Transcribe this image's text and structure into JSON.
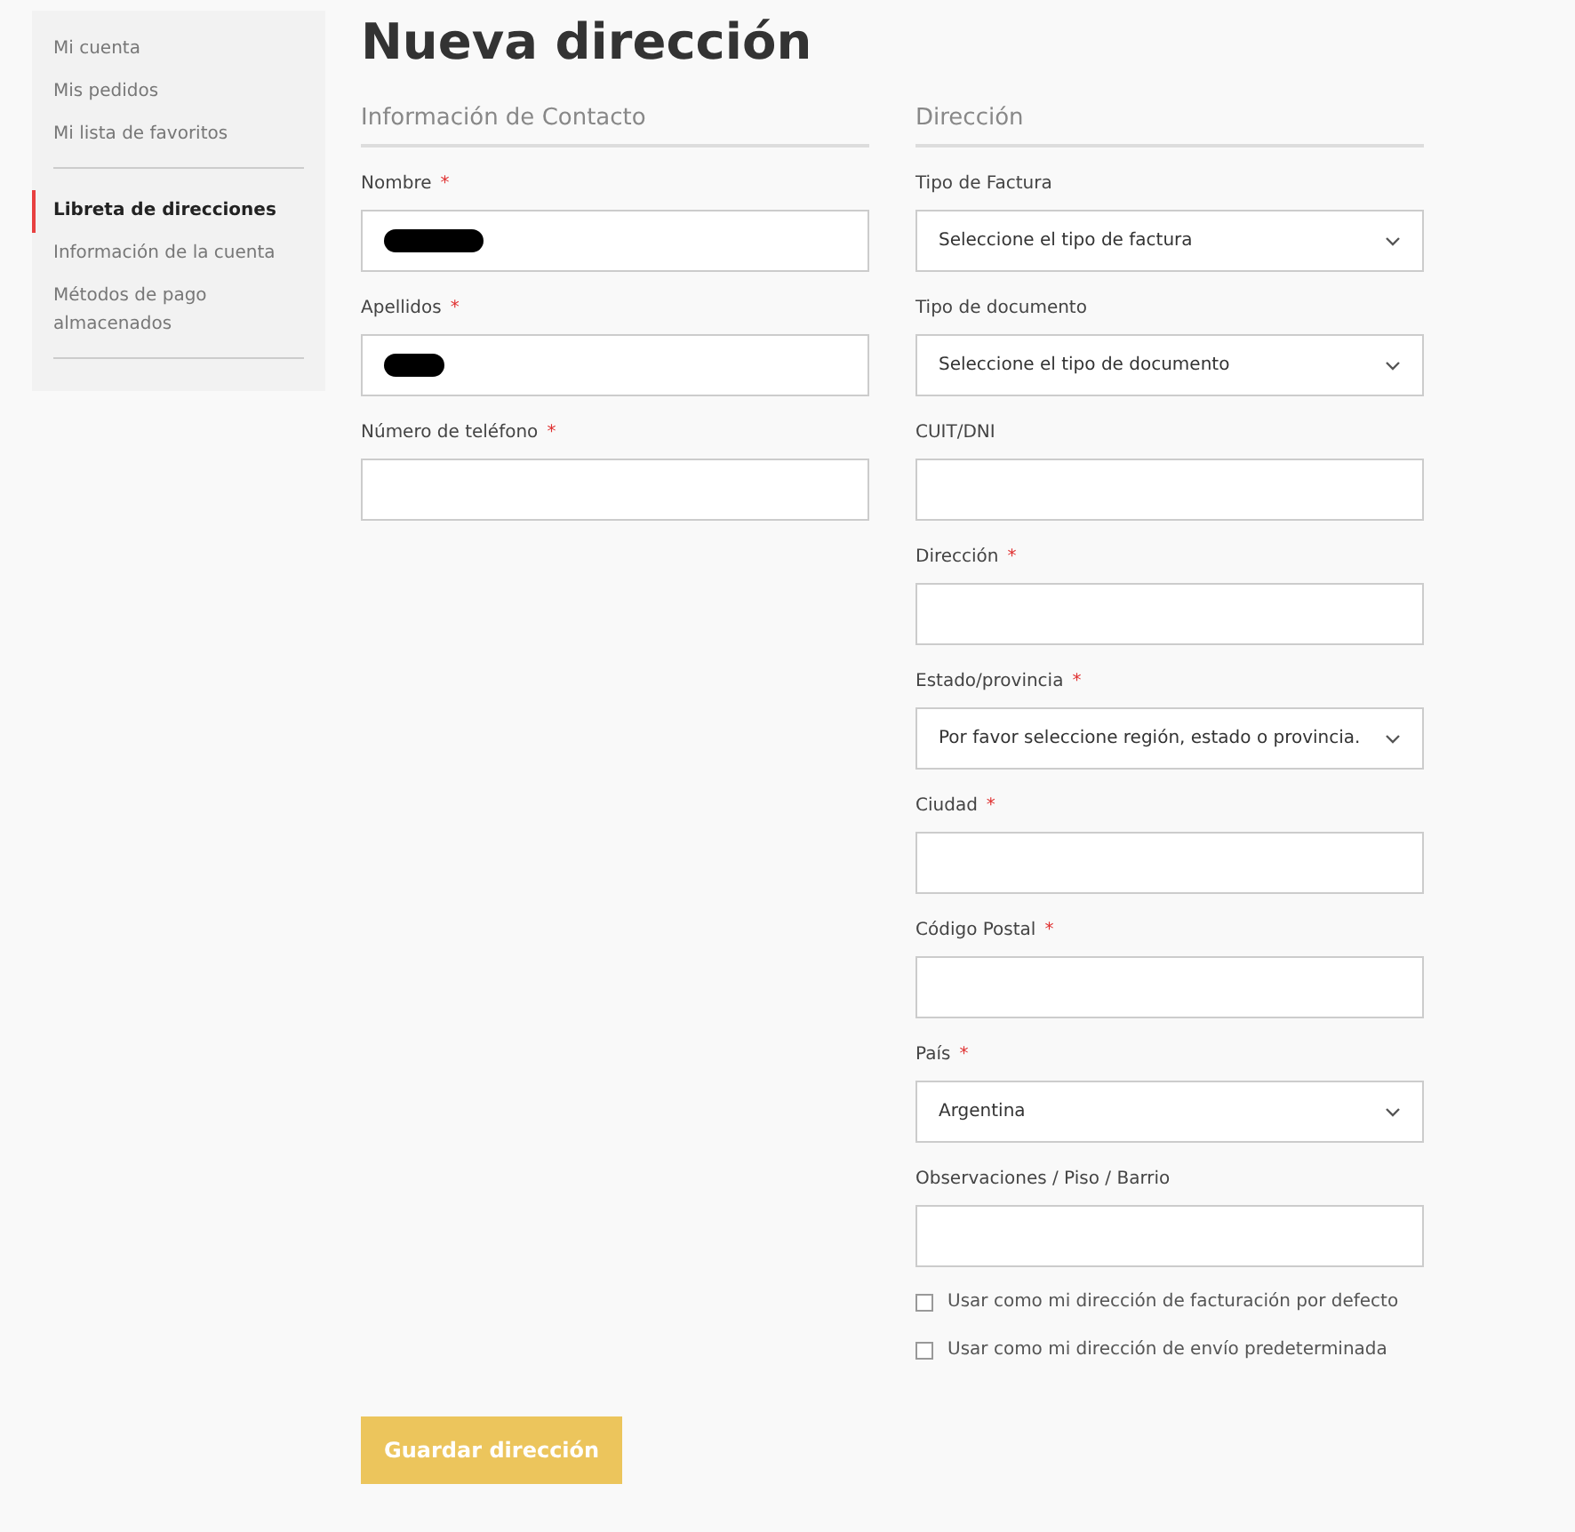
{
  "sidebar": {
    "groups": [
      {
        "items": [
          {
            "label": "Mi cuenta",
            "selected": false
          },
          {
            "label": "Mis pedidos",
            "selected": false
          },
          {
            "label": "Mi lista de favoritos",
            "selected": false
          }
        ]
      },
      {
        "items": [
          {
            "label": "Libreta de direcciones",
            "selected": true
          },
          {
            "label": "Información de la cuenta",
            "selected": false
          },
          {
            "label": "Métodos de pago almacenados",
            "selected": false
          }
        ]
      }
    ]
  },
  "title": "Nueva dirección",
  "sections": [
    {
      "heading": "Información de Contacto",
      "fields": [
        {
          "kind": "text",
          "label": "Nombre",
          "required": true,
          "redacted": true
        },
        {
          "kind": "text",
          "label": "Apellidos",
          "required": true,
          "redacted": true
        },
        {
          "kind": "text",
          "label": "Número de teléfono",
          "required": true,
          "redacted": false
        }
      ]
    },
    {
      "heading": "Dirección",
      "fields": [
        {
          "kind": "select",
          "label": "Tipo de Factura",
          "required": false,
          "value": "Seleccione el tipo de factura"
        },
        {
          "kind": "select",
          "label": "Tipo de documento",
          "required": false,
          "value": "Seleccione el tipo de documento"
        },
        {
          "kind": "text",
          "label": "CUIT/DNI",
          "required": false,
          "redacted": false
        },
        {
          "kind": "text",
          "label": "Dirección",
          "required": true,
          "redacted": false
        },
        {
          "kind": "select",
          "label": "Estado/provincia",
          "required": true,
          "value": "Por favor seleccione región, estado o provincia."
        },
        {
          "kind": "text",
          "label": "Ciudad",
          "required": true,
          "redacted": false
        },
        {
          "kind": "text",
          "label": "Código Postal",
          "required": true,
          "redacted": false
        },
        {
          "kind": "select",
          "label": "País",
          "required": true,
          "value": "Argentina"
        },
        {
          "kind": "text",
          "label": "Observaciones / Piso / Barrio",
          "required": false,
          "redacted": false
        }
      ],
      "checkboxes": [
        {
          "label": "Usar como mi dirección de facturación por defecto",
          "checked": false
        },
        {
          "label": "Usar como mi dirección de envío predeterminada",
          "checked": false
        }
      ]
    }
  ],
  "required_mark": "*",
  "save_button": "Guardar dirección"
}
